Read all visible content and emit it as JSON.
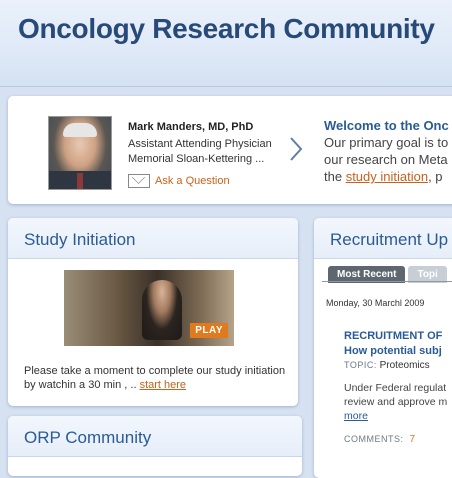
{
  "header": {
    "title": "Oncology Research Community"
  },
  "featured": {
    "name": "Mark Manders, MD, PhD",
    "title": "Assistant Attending Physician",
    "org": "Memorial Sloan-Kettering ...",
    "ask_label": "Ask a Question",
    "photo_icon": "physician-photo",
    "next_icon": "chevron-right-icon"
  },
  "welcome": {
    "title": "Welcome to the Onc",
    "line1": "Our primary goal is to",
    "line2": "our research on Meta",
    "line3_prefix": "the ",
    "line3_link": "study initiation",
    "line3_suffix": ", p"
  },
  "study": {
    "title": "Study Initiation",
    "play_label": "PLAY",
    "text": "Please take a moment to complete our study initiation by watchin a 30 min , ..",
    "link": "start here"
  },
  "orp": {
    "title": "ORP Community"
  },
  "recruit": {
    "title": "Recruitment Up",
    "tabs": [
      "Most Recent",
      "Topi"
    ],
    "date": "Monday, 30 Marchl 2009",
    "item_title_1": "RECRUITMENT OF",
    "item_title_2": "How potential subj",
    "topic_label": "TOPIC:",
    "topic_value": "Proteomics",
    "body_1": "Under Federal regulat",
    "body_2": "review and approve m",
    "more": "more",
    "comments_label": "COMMENTS:",
    "comments_count": "7"
  },
  "colors": {
    "accent": "#2a5b97",
    "link": "#c8611c",
    "play": "#e07a1f"
  }
}
